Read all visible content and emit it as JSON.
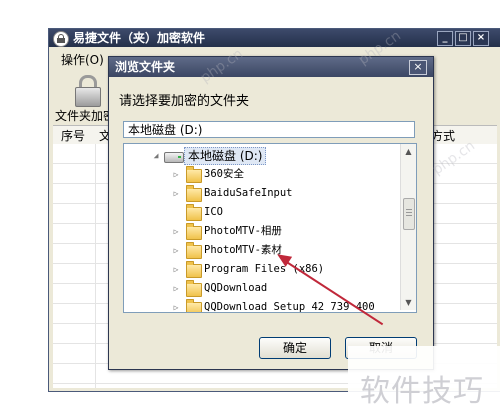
{
  "main_window": {
    "title": "易捷文件（夹）加密软件",
    "controls": {
      "minimize": "_",
      "maximize": "□",
      "close": "×"
    },
    "menu": {
      "operations": "操作(O)"
    },
    "toolbar": {
      "folder_encrypt_label": "文件夹加密"
    },
    "list_columns": {
      "index": "序号",
      "file": "文",
      "method": "方式"
    }
  },
  "dialog": {
    "title": "浏览文件夹",
    "close": "×",
    "prompt": "请选择要加密的文件夹",
    "path_value": "本地磁盘 (D:)",
    "tree": {
      "root": "本地磁盘 (D:)",
      "folders": [
        "360安全",
        "BaiduSafeInput",
        "ICO",
        "PhotoMTV-相册",
        "PhotoMTV-素材",
        "Program Files (x86)",
        "QQDownload",
        "QQDownload_Setup_42_739_400"
      ]
    },
    "buttons": {
      "ok": "确定",
      "cancel": "取消"
    }
  },
  "watermarks": {
    "diagonal": "php.cn",
    "corner": "软件技巧"
  }
}
